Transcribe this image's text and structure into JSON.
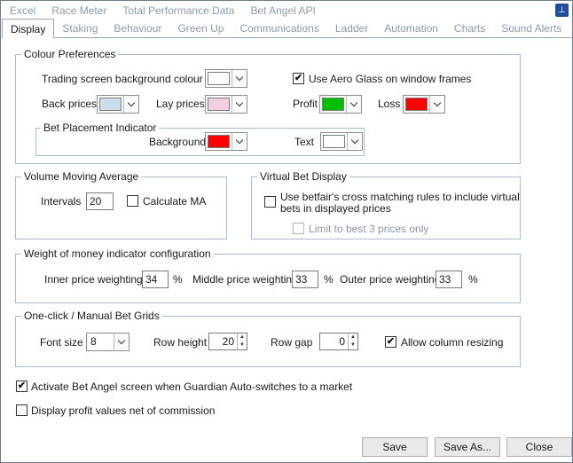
{
  "tabs_row1": [
    "Excel",
    "Race Meter",
    "Total Performance Data",
    "Bet Angel API"
  ],
  "tabs_row2": [
    "Display",
    "Staking",
    "Behaviour",
    "Green Up",
    "Communications",
    "Ladder",
    "Automation",
    "Charts",
    "Sound Alerts"
  ],
  "active_tab": "Display",
  "colour_prefs": {
    "legend": "Colour Preferences",
    "trading_bg_label": "Trading screen background colour",
    "aero_label": "Use Aero Glass on window frames",
    "aero_checked": "✔",
    "back_label": "Back prices",
    "lay_label": "Lay prices",
    "profit_label": "Profit",
    "loss_label": "Loss",
    "colors": {
      "trading_bg": "#ffffff",
      "back": "#cfdde8",
      "lay": "#f2cfe0",
      "profit": "#00c000",
      "loss": "#ff0000",
      "bet_bg": "#ff0000",
      "bet_text": "#ffffff"
    },
    "bet_placement": {
      "legend": "Bet Placement Indicator",
      "background_label": "Background",
      "text_label": "Text"
    }
  },
  "volume": {
    "legend": "Volume Moving Average",
    "intervals_label": "Intervals",
    "intervals_value": "20",
    "calc_label": "Calculate MA",
    "calc_checked": ""
  },
  "virtual_bet": {
    "legend": "Virtual Bet Display",
    "cross_label_1": "Use betfair's cross matching rules to include virtual",
    "cross_label_2": "bets in displayed prices",
    "cross_checked": "",
    "limit_label": "Limit to best 3 prices only",
    "limit_checked": ""
  },
  "wom": {
    "legend": "Weight of money indicator configuration",
    "inner_label": "Inner price weighting",
    "inner_value": "34",
    "middle_label": "Middle price weighting",
    "middle_value": "33",
    "outer_label": "Outer price weighting",
    "outer_value": "33",
    "pct": "%"
  },
  "grids": {
    "legend": "One-click / Manual Bet Grids",
    "font_size_label": "Font size",
    "font_size_value": "8",
    "row_height_label": "Row height",
    "row_height_value": "20",
    "row_gap_label": "Row gap",
    "row_gap_value": "0",
    "resize_label": "Allow column resizing",
    "resize_checked": "✔"
  },
  "activate_label": "Activate Bet Angel screen when Guardian Auto-switches to a market",
  "activate_checked": "✔",
  "net_label": "Display profit values net of commission",
  "net_checked": "",
  "buttons": {
    "save": "Save",
    "save_as": "Save As...",
    "close": "Close"
  }
}
